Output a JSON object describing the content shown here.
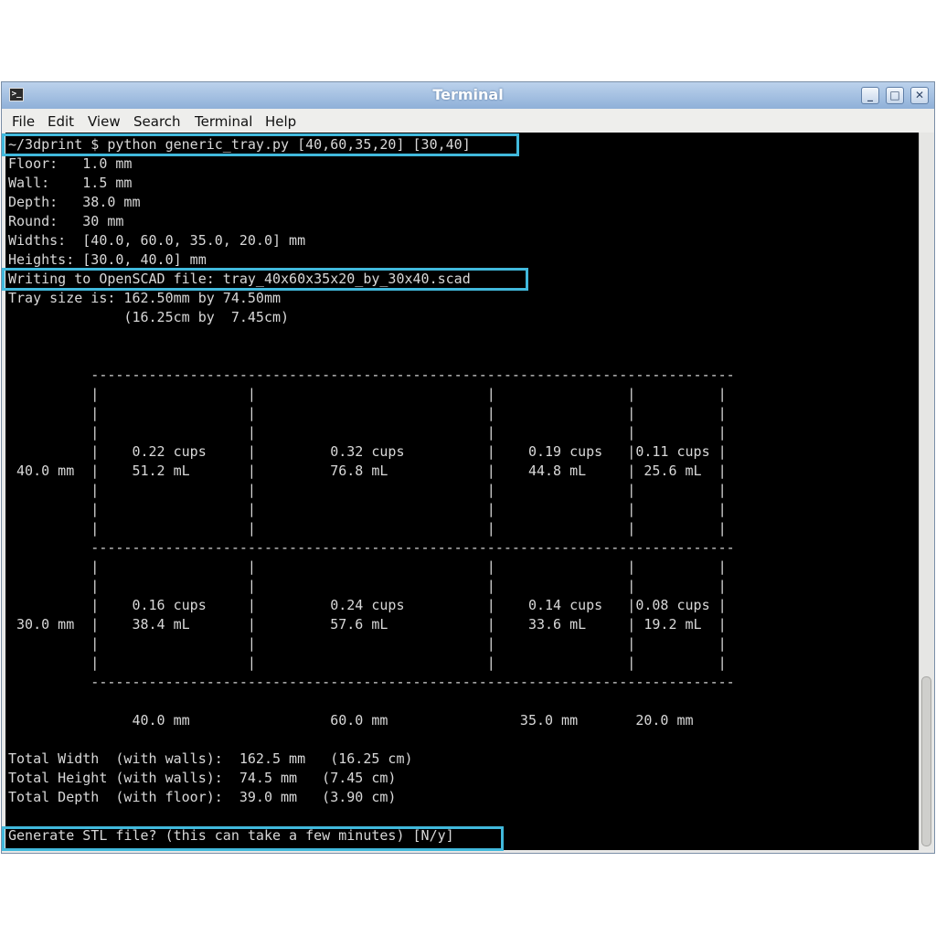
{
  "window": {
    "title": "Terminal",
    "icon": "terminal-icon"
  },
  "window_buttons": {
    "minimize": "_",
    "maximize": "□",
    "close": "✕"
  },
  "menu": [
    "File",
    "Edit",
    "View",
    "Search",
    "Terminal",
    "Help"
  ],
  "terminal": {
    "lines": [
      "~/3dprint $ python generic_tray.py [40,60,35,20] [30,40]",
      "Floor:   1.0 mm",
      "Wall:    1.5 mm",
      "Depth:   38.0 mm",
      "Round:   30 mm",
      "Widths:  [40.0, 60.0, 35.0, 20.0] mm",
      "Heights: [30.0, 40.0] mm",
      "Writing to OpenSCAD file: tray_40x60x35x20_by_30x40.scad",
      "Tray size is: 162.50mm by 74.50mm",
      "              (16.25cm by  7.45cm)",
      "",
      "",
      "          ------------------------------------------------------------------------------",
      "          |                  |                            |                |          |",
      "          |                  |                            |                |          |",
      "          |                  |                            |                |          |",
      "          |    0.22 cups     |         0.32 cups          |    0.19 cups   |0.11 cups |",
      " 40.0 mm  |    51.2 mL       |         76.8 mL            |    44.8 mL     | 25.6 mL  |",
      "          |                  |                            |                |          |",
      "          |                  |                            |                |          |",
      "          |                  |                            |                |          |",
      "          ------------------------------------------------------------------------------",
      "          |                  |                            |                |          |",
      "          |                  |                            |                |          |",
      "          |    0.16 cups     |         0.24 cups          |    0.14 cups   |0.08 cups |",
      " 30.0 mm  |    38.4 mL       |         57.6 mL            |    33.6 mL     | 19.2 mL  |",
      "          |                  |                            |                |          |",
      "          |                  |                            |                |          |",
      "          ------------------------------------------------------------------------------",
      "",
      "               40.0 mm                 60.0 mm                35.0 mm       20.0 mm",
      "",
      "Total Width  (with walls):  162.5 mm   (16.25 cm)",
      "Total Height (with walls):  74.5 mm   (7.45 cm)",
      "Total Depth  (with floor):  39.0 mm   (3.90 cm)",
      "",
      "Generate STL file? (this can take a few minutes) [N/y]"
    ]
  },
  "highlight_color": "#41b9dc"
}
